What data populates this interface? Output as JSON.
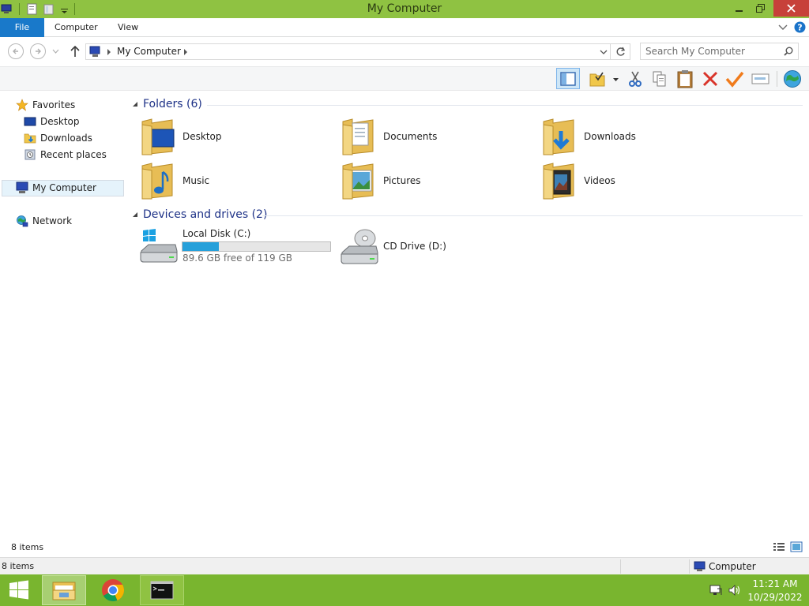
{
  "window": {
    "title": "My Computer",
    "accent": "#8fc242"
  },
  "ribbon": {
    "tabs": [
      {
        "label": "File"
      },
      {
        "label": "Computer"
      },
      {
        "label": "View"
      }
    ]
  },
  "address": {
    "path": "My Computer"
  },
  "search": {
    "placeholder": "Search My Computer"
  },
  "nav": {
    "favorites": "Favorites",
    "items": [
      {
        "label": "Desktop"
      },
      {
        "label": "Downloads"
      },
      {
        "label": "Recent places"
      }
    ],
    "computer": "My Computer",
    "network": "Network"
  },
  "folders": {
    "header": "Folders (6)",
    "items": [
      {
        "label": "Desktop"
      },
      {
        "label": "Documents"
      },
      {
        "label": "Downloads"
      },
      {
        "label": "Music"
      },
      {
        "label": "Pictures"
      },
      {
        "label": "Videos"
      }
    ]
  },
  "drives": {
    "header": "Devices and drives (2)",
    "local": {
      "label": "Local Disk (C:)",
      "free_text": "89.6 GB free of 119 GB",
      "used_fraction": 0.247
    },
    "cd": {
      "label": "CD Drive (D:)"
    }
  },
  "status": {
    "items": "8 items",
    "items_bottom": "8 items",
    "computer": "Computer"
  },
  "taskbar": {
    "time": "11:21 AM",
    "date": "10/29/2022"
  }
}
